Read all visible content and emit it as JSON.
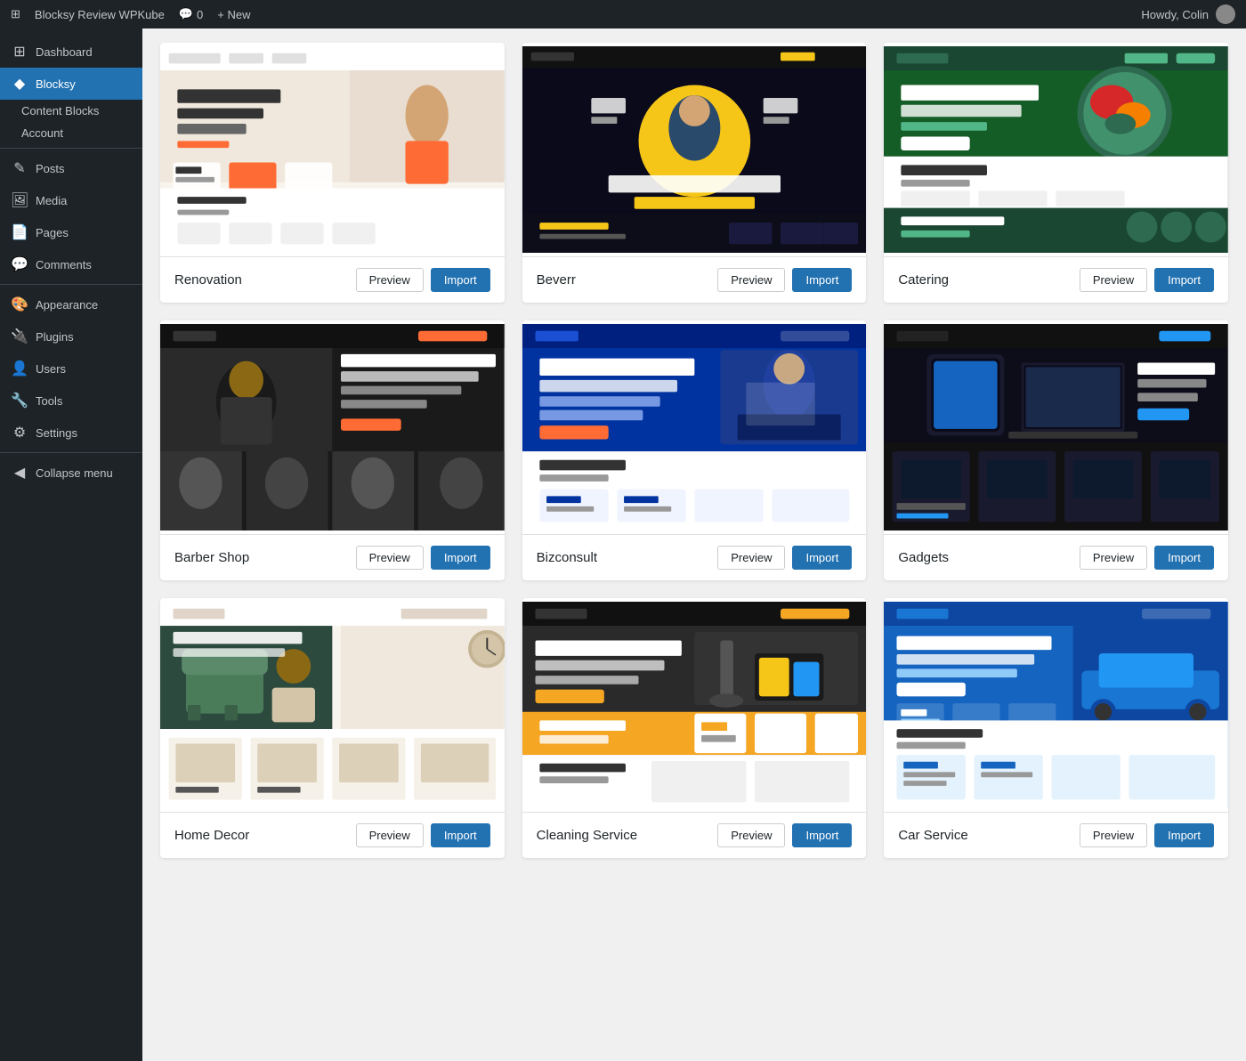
{
  "adminBar": {
    "siteName": "Blocksy Review WPKube",
    "commentsCount": "0",
    "newLabel": "+ New",
    "howdy": "Howdy, Colin"
  },
  "sidebar": {
    "logo": "⊞",
    "blocksy_section": "Blocksy",
    "items": [
      {
        "id": "dashboard",
        "label": "Dashboard",
        "icon": "⊞"
      },
      {
        "id": "blocksy",
        "label": "Blocksy",
        "icon": "◆",
        "active": true
      },
      {
        "id": "content-blocks",
        "label": "Content Blocks",
        "sub": true
      },
      {
        "id": "account",
        "label": "Account",
        "sub": true
      },
      {
        "id": "posts",
        "label": "Posts",
        "icon": "✎"
      },
      {
        "id": "media",
        "label": "Media",
        "icon": "🖼"
      },
      {
        "id": "pages",
        "label": "Pages",
        "icon": "📄"
      },
      {
        "id": "comments",
        "label": "Comments",
        "icon": "💬"
      },
      {
        "id": "appearance",
        "label": "Appearance",
        "icon": "🎨"
      },
      {
        "id": "plugins",
        "label": "Plugins",
        "icon": "🔌"
      },
      {
        "id": "users",
        "label": "Users",
        "icon": "👤"
      },
      {
        "id": "tools",
        "label": "Tools",
        "icon": "🔧"
      },
      {
        "id": "settings",
        "label": "Settings",
        "icon": "⚙"
      },
      {
        "id": "collapse",
        "label": "Collapse menu",
        "icon": "◀"
      }
    ]
  },
  "templates": [
    {
      "id": "renovation",
      "name": "Renovation",
      "thumbClass": "thumb-renovation",
      "previewLabel": "Preview",
      "importLabel": "Import"
    },
    {
      "id": "beverr",
      "name": "Beverr",
      "thumbClass": "thumb-beverr",
      "previewLabel": "Preview",
      "importLabel": "Import"
    },
    {
      "id": "catering",
      "name": "Catering",
      "thumbClass": "thumb-catering",
      "previewLabel": "Preview",
      "importLabel": "Import"
    },
    {
      "id": "barber-shop",
      "name": "Barber Shop",
      "thumbClass": "thumb-barbershop",
      "previewLabel": "Preview",
      "importLabel": "Import"
    },
    {
      "id": "bizconsult",
      "name": "Bizconsult",
      "thumbClass": "thumb-bizconsult",
      "previewLabel": "Preview",
      "importLabel": "Import"
    },
    {
      "id": "gadgets",
      "name": "Gadgets",
      "thumbClass": "thumb-gadgets",
      "previewLabel": "Preview",
      "importLabel": "Import"
    },
    {
      "id": "home-decor",
      "name": "Home Decor",
      "thumbClass": "thumb-homedecor",
      "previewLabel": "Preview",
      "importLabel": "Import"
    },
    {
      "id": "cleaning-service",
      "name": "Cleaning Service",
      "thumbClass": "thumb-cleaning",
      "previewLabel": "Preview",
      "importLabel": "Import"
    },
    {
      "id": "car-service",
      "name": "Car Service",
      "thumbClass": "thumb-carservice",
      "previewLabel": "Preview",
      "importLabel": "Import"
    }
  ]
}
